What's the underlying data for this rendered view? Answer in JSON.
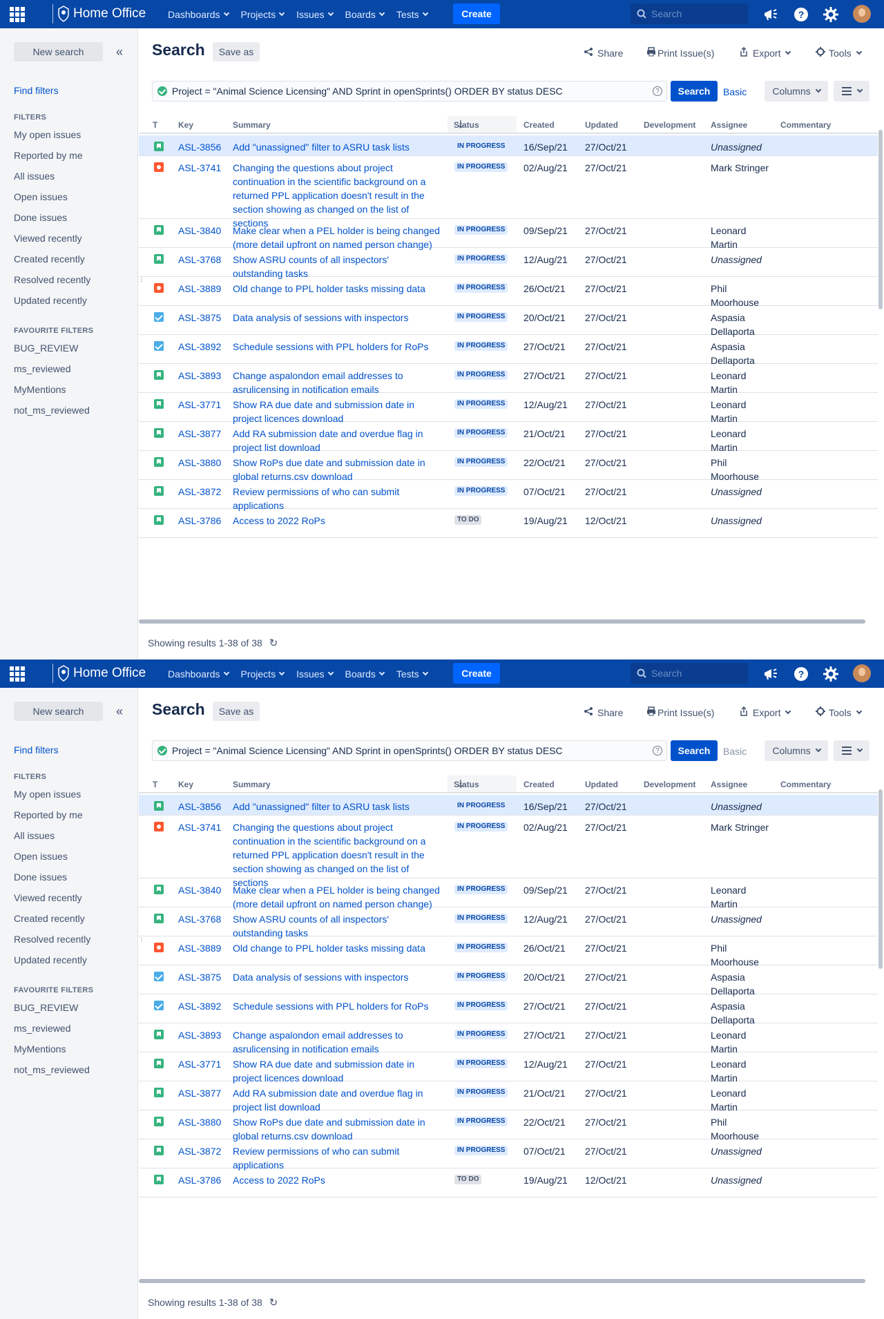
{
  "topnav": {
    "brand": "Home Office",
    "menus": [
      "Dashboards",
      "Projects",
      "Issues",
      "Boards",
      "Tests"
    ],
    "create_label": "Create",
    "search_placeholder": "Search",
    "icons": [
      "app-switcher-icon",
      "megaphone-icon",
      "help-icon",
      "settings-icon",
      "avatar"
    ]
  },
  "sidebar": {
    "new_search": "New search",
    "find_filters": "Find filters",
    "filters_heading": "FILTERS",
    "filters": [
      "My open issues",
      "Reported by me",
      "All issues",
      "Open issues",
      "Done issues",
      "Viewed recently",
      "Created recently",
      "Resolved recently",
      "Updated recently"
    ],
    "favourites_heading": "FAVOURITE FILTERS",
    "favourites": [
      "BUG_REVIEW",
      "ms_reviewed",
      "MyMentions",
      "not_ms_reviewed"
    ]
  },
  "main": {
    "title": "Search",
    "save_as": "Save as",
    "share": "Share",
    "print": "Print Issue(s)",
    "export": "Export",
    "tools": "Tools",
    "jql": "Project = \"Animal Science Licensing\"  AND Sprint in openSprints() ORDER BY status DESC",
    "search_button": "Search",
    "basic": "Basic",
    "columns": "Columns",
    "footer": "Showing results 1-38 of 38"
  },
  "table": {
    "headers": {
      "t": "T",
      "key": "Key",
      "summary": "Summary",
      "status": "Status",
      "created": "Created",
      "updated": "Updated",
      "development": "Development",
      "assignee": "Assignee",
      "commentary": "Commentary"
    },
    "rows": [
      {
        "type": "story",
        "key": "ASL-3856",
        "summary": "Add \"unassigned\" filter to ASRU task lists",
        "status": "IN PROGRESS",
        "created": "16/Sep/21",
        "updated": "27/Oct/21",
        "assignee": "Unassigned"
      },
      {
        "type": "bug",
        "key": "ASL-3741",
        "summary": "Changing the questions about project continuation in the scientific background on a returned PPL application doesn't result in the section showing as changed on the list of sections",
        "status": "IN PROGRESS",
        "created": "02/Aug/21",
        "updated": "27/Oct/21",
        "assignee": "Mark Stringer"
      },
      {
        "type": "story",
        "key": "ASL-3840",
        "summary": "Make clear when a PEL holder is being changed (more detail upfront on named person change)",
        "status": "IN PROGRESS",
        "created": "09/Sep/21",
        "updated": "27/Oct/21",
        "assignee": "Leonard Martin"
      },
      {
        "type": "story",
        "key": "ASL-3768",
        "summary": "Show ASRU counts of all inspectors' outstanding tasks",
        "status": "IN PROGRESS",
        "created": "12/Aug/21",
        "updated": "27/Oct/21",
        "assignee": "Unassigned"
      },
      {
        "type": "bug",
        "key": "ASL-3889",
        "summary": "Old change to PPL holder tasks missing data",
        "status": "IN PROGRESS",
        "created": "26/Oct/21",
        "updated": "27/Oct/21",
        "assignee": "Phil Moorhouse"
      },
      {
        "type": "task",
        "key": "ASL-3875",
        "summary": "Data analysis of sessions with inspectors",
        "status": "IN PROGRESS",
        "created": "20/Oct/21",
        "updated": "27/Oct/21",
        "assignee": "Aspasia Dellaporta"
      },
      {
        "type": "task",
        "key": "ASL-3892",
        "summary": "Schedule sessions with PPL holders for RoPs",
        "status": "IN PROGRESS",
        "created": "27/Oct/21",
        "updated": "27/Oct/21",
        "assignee": "Aspasia Dellaporta"
      },
      {
        "type": "story",
        "key": "ASL-3893",
        "summary": "Change aspalondon email addresses to asrulicensing in notification emails",
        "status": "IN PROGRESS",
        "created": "27/Oct/21",
        "updated": "27/Oct/21",
        "assignee": "Leonard Martin"
      },
      {
        "type": "story",
        "key": "ASL-3771",
        "summary": "Show RA due date and submission date in project licences download",
        "status": "IN PROGRESS",
        "created": "12/Aug/21",
        "updated": "27/Oct/21",
        "assignee": "Leonard Martin"
      },
      {
        "type": "story",
        "key": "ASL-3877",
        "summary": "Add RA submission date and overdue flag in project list download",
        "status": "IN PROGRESS",
        "created": "21/Oct/21",
        "updated": "27/Oct/21",
        "assignee": "Leonard Martin"
      },
      {
        "type": "story",
        "key": "ASL-3880",
        "summary": "Show RoPs due date and submission date in global returns.csv download",
        "status": "IN PROGRESS",
        "created": "22/Oct/21",
        "updated": "27/Oct/21",
        "assignee": "Phil Moorhouse"
      },
      {
        "type": "story",
        "key": "ASL-3872",
        "summary": "Review permissions of who can submit applications",
        "status": "IN PROGRESS",
        "created": "07/Oct/21",
        "updated": "27/Oct/21",
        "assignee": "Unassigned"
      },
      {
        "type": "story",
        "key": "ASL-3786",
        "summary": "Access to 2022 RoPs",
        "status": "TO DO",
        "created": "19/Aug/21",
        "updated": "12/Oct/21",
        "assignee": "Unassigned"
      }
    ]
  },
  "colors": {
    "nav": "#0747a6",
    "accent": "#0052cc",
    "selected_row": "#deebff"
  }
}
